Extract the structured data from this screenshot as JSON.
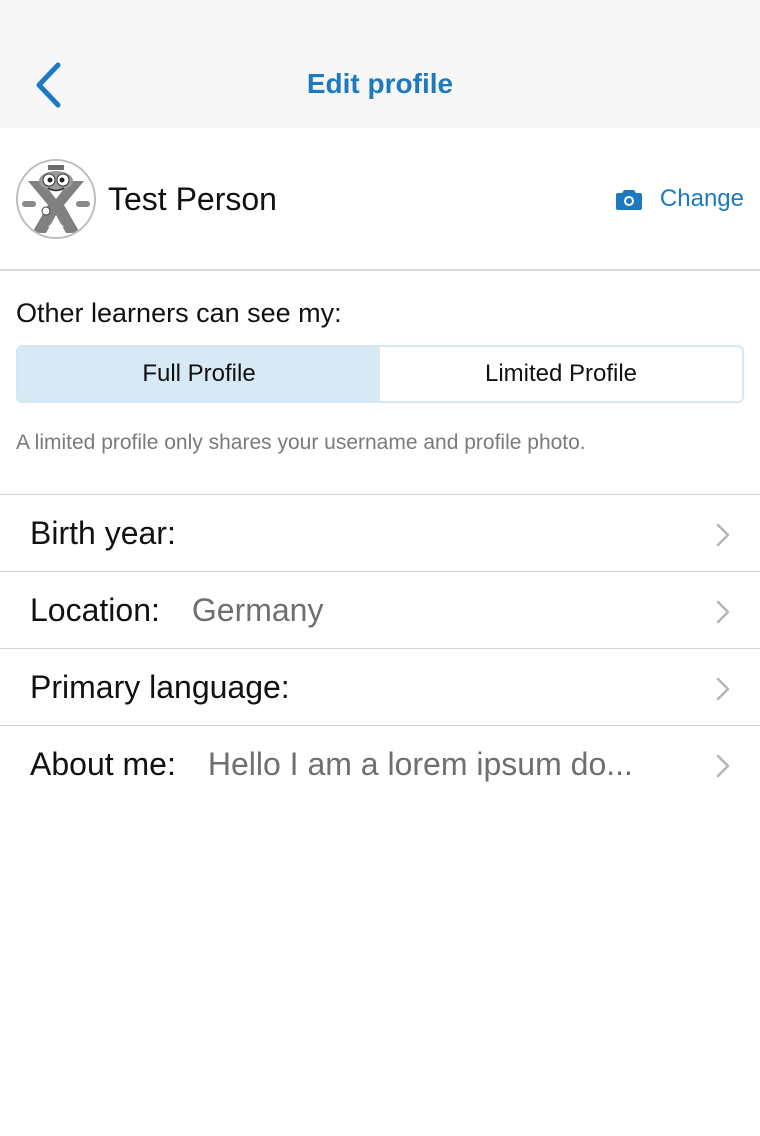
{
  "header": {
    "title": "Edit profile",
    "back_icon": "chevron-left-icon"
  },
  "profile": {
    "name": "Test Person",
    "avatar": "robot-avatar",
    "change_label": "Change",
    "change_icon": "camera-icon"
  },
  "visibility": {
    "label": "Other learners can see my:",
    "options": [
      "Full Profile",
      "Limited Profile"
    ],
    "selected": "Full Profile",
    "hint": "A limited profile only shares your username and profile photo."
  },
  "fields": [
    {
      "label": "Birth year:",
      "value": ""
    },
    {
      "label": "Location:",
      "value": "Germany"
    },
    {
      "label": "Primary language:",
      "value": ""
    },
    {
      "label": "About me:",
      "value": "Hello I am a lorem ipsum do..."
    }
  ],
  "colors": {
    "accent": "#1d7ac0",
    "segment_active": "#d6e9f5",
    "header_bg": "#f7f7f7"
  }
}
